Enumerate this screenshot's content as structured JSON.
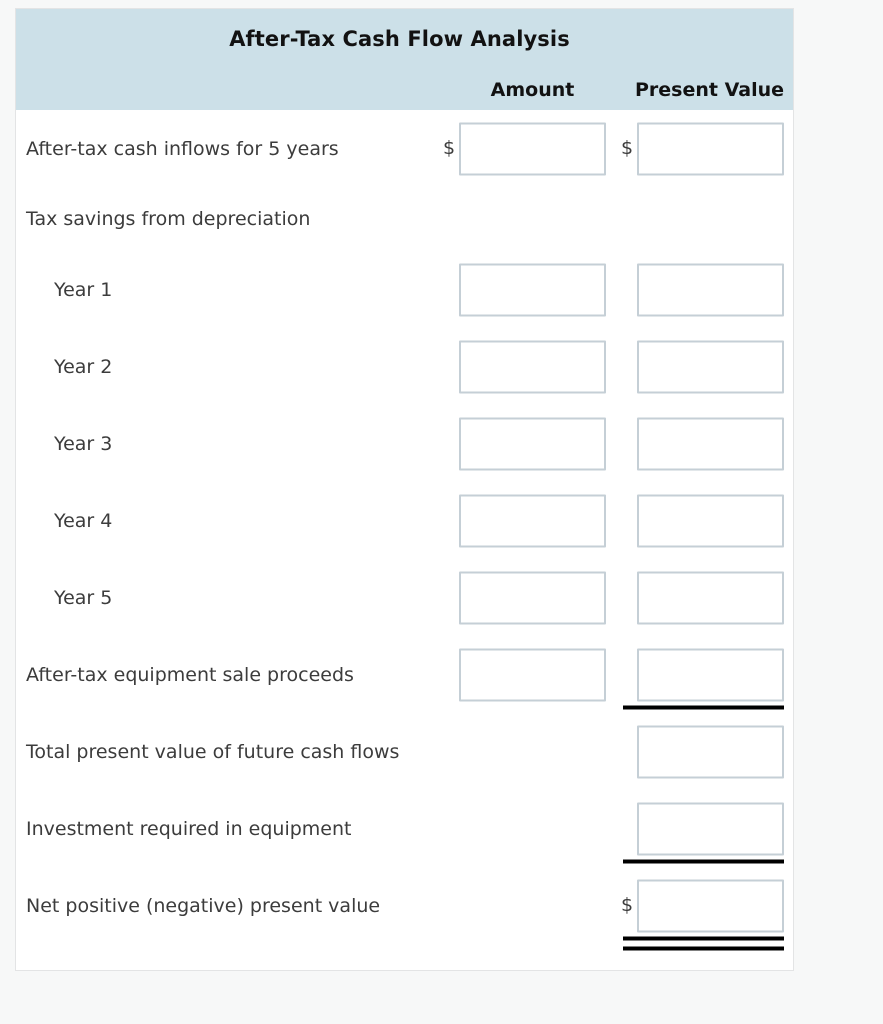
{
  "worksheet": {
    "title": "After-Tax Cash Flow Analysis",
    "columns": {
      "amount": "Amount",
      "present_value": "Present Value"
    },
    "currency_symbol": "$",
    "colors": {
      "header_band": "#cce0e8",
      "page_background": "#f7f8f8",
      "card_background": "#ffffff",
      "input_border": "#c5cfd6",
      "rule": "#000000",
      "label_text": "#3c3c3c",
      "heading_text": "#121212"
    },
    "rows": [
      {
        "label": "After-tax cash inflows for 5 years",
        "indent": false,
        "amount": {
          "show": true,
          "value": "",
          "placeholder": "",
          "dollar": true,
          "rule": "none"
        },
        "present_value": {
          "show": true,
          "value": "",
          "placeholder": "",
          "dollar": true,
          "rule": "none"
        }
      },
      {
        "label": "Tax savings from depreciation",
        "indent": false,
        "amount": {
          "show": false
        },
        "present_value": {
          "show": false
        }
      },
      {
        "label": "Year 1",
        "indent": true,
        "amount": {
          "show": true,
          "value": "",
          "placeholder": "",
          "dollar": false,
          "rule": "none"
        },
        "present_value": {
          "show": true,
          "value": "",
          "placeholder": "",
          "dollar": false,
          "rule": "none"
        }
      },
      {
        "label": "Year 2",
        "indent": true,
        "amount": {
          "show": true,
          "value": "",
          "placeholder": "",
          "dollar": false,
          "rule": "none"
        },
        "present_value": {
          "show": true,
          "value": "",
          "placeholder": "",
          "dollar": false,
          "rule": "none"
        }
      },
      {
        "label": "Year 3",
        "indent": true,
        "amount": {
          "show": true,
          "value": "",
          "placeholder": "",
          "dollar": false,
          "rule": "none"
        },
        "present_value": {
          "show": true,
          "value": "",
          "placeholder": "",
          "dollar": false,
          "rule": "none"
        }
      },
      {
        "label": "Year 4",
        "indent": true,
        "amount": {
          "show": true,
          "value": "",
          "placeholder": "",
          "dollar": false,
          "rule": "none"
        },
        "present_value": {
          "show": true,
          "value": "",
          "placeholder": "",
          "dollar": false,
          "rule": "none"
        }
      },
      {
        "label": "Year 5",
        "indent": true,
        "amount": {
          "show": true,
          "value": "",
          "placeholder": "",
          "dollar": false,
          "rule": "none"
        },
        "present_value": {
          "show": true,
          "value": "",
          "placeholder": "",
          "dollar": false,
          "rule": "none"
        }
      },
      {
        "label": "After-tax equipment sale proceeds",
        "indent": false,
        "amount": {
          "show": true,
          "value": "",
          "placeholder": "",
          "dollar": false,
          "rule": "none"
        },
        "present_value": {
          "show": true,
          "value": "",
          "placeholder": "",
          "dollar": false,
          "rule": "single"
        }
      },
      {
        "label": "Total present value of future cash flows",
        "indent": false,
        "amount": {
          "show": false
        },
        "present_value": {
          "show": true,
          "value": "",
          "placeholder": "",
          "dollar": false,
          "rule": "none"
        }
      },
      {
        "label": "Investment required in equipment",
        "indent": false,
        "amount": {
          "show": false
        },
        "present_value": {
          "show": true,
          "value": "",
          "placeholder": "",
          "dollar": false,
          "rule": "single"
        }
      },
      {
        "label": "Net positive (negative) present value",
        "indent": false,
        "amount": {
          "show": false
        },
        "present_value": {
          "show": true,
          "value": "",
          "placeholder": "",
          "dollar": true,
          "rule": "double"
        }
      }
    ]
  }
}
